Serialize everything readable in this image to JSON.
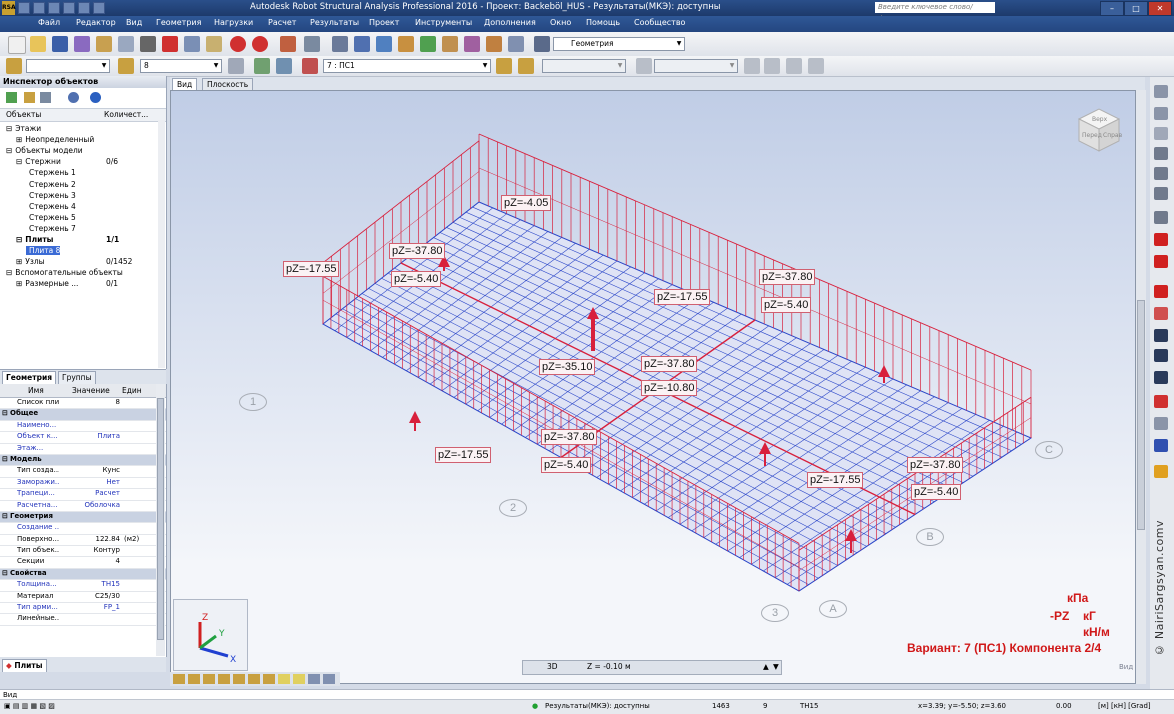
{
  "window": {
    "title": "Autodesk Robot Structural Analysis Professional 2016 - Проект: Backeböl_HUS - Результаты(МКЭ): доступны",
    "search_placeholder": "Введите ключевое слово/фразу",
    "logo": "RSA",
    "btn_min": "–",
    "btn_max": "□",
    "btn_close": "✕"
  },
  "menu": [
    "Файл",
    "Редактор",
    "Вид",
    "Геометрия",
    "Нагрузки",
    "Расчет",
    "Результаты",
    "Проект",
    "Инструменты",
    "Дополнения",
    "Окно",
    "Помощь",
    "Сообщество"
  ],
  "toolbar": {
    "layout_combo": "Геометрия",
    "section_combo": "8",
    "case_combo": "7 : ПС1"
  },
  "inspector": {
    "title": "Инспектор объектов",
    "col_objects": "Объекты",
    "col_count": "Количест...",
    "tree": [
      {
        "label": "Этажи",
        "count": "",
        "indent": 0,
        "expand": "⊟"
      },
      {
        "label": "Неопределенный",
        "count": "",
        "indent": 1,
        "expand": "⊞"
      },
      {
        "label": "Объекты модели",
        "count": "",
        "indent": 0,
        "expand": "⊟"
      },
      {
        "label": "Стержни",
        "count": "0/6",
        "indent": 1,
        "expand": "⊟"
      },
      {
        "label": "Стержень    1",
        "count": "",
        "indent": 2,
        "expand": ""
      },
      {
        "label": "Стержень    2",
        "count": "",
        "indent": 2,
        "expand": ""
      },
      {
        "label": "Стержень    3",
        "count": "",
        "indent": 2,
        "expand": ""
      },
      {
        "label": "Стержень    4",
        "count": "",
        "indent": 2,
        "expand": ""
      },
      {
        "label": "Стержень    5",
        "count": "",
        "indent": 2,
        "expand": ""
      },
      {
        "label": "Стержень    7",
        "count": "",
        "indent": 2,
        "expand": ""
      },
      {
        "label": "Плиты",
        "count": "1/1",
        "indent": 1,
        "expand": "⊟",
        "bold": true
      },
      {
        "label": "Плита    8",
        "count": "",
        "indent": 2,
        "expand": "",
        "selected": true
      },
      {
        "label": "Узлы",
        "count": "0/1452",
        "indent": 1,
        "expand": "⊞"
      },
      {
        "label": "Вспомогательные объекты",
        "count": "",
        "indent": 0,
        "expand": "⊟"
      },
      {
        "label": "Размерные ...",
        "count": "0/1",
        "indent": 1,
        "expand": "⊞"
      }
    ]
  },
  "tabs": {
    "geometry": "Геометрия",
    "groups": "Группы",
    "bottom": "Плиты"
  },
  "props": {
    "col_name": "Имя",
    "col_value": "Значение",
    "col_unit": "Един",
    "rows": [
      {
        "n": "Список плит",
        "v": "8",
        "u": "",
        "type": "plain"
      },
      {
        "n": "Общее",
        "v": "",
        "u": "",
        "type": "cat"
      },
      {
        "n": "Наимено...",
        "v": "",
        "u": "",
        "type": "blue"
      },
      {
        "n": "Объект к...",
        "v": "Плита",
        "u": "",
        "type": "blue"
      },
      {
        "n": "Этаж...",
        "v": "",
        "u": "",
        "type": "blue"
      },
      {
        "n": "Модель",
        "v": "",
        "u": "",
        "type": "cat"
      },
      {
        "n": "Тип созда...",
        "v": "Кунс",
        "u": "",
        "type": "plain"
      },
      {
        "n": "Заморажи...",
        "v": "Нет",
        "u": "",
        "type": "blue"
      },
      {
        "n": "Трапеци...",
        "v": "Расчет",
        "u": "",
        "type": "blue"
      },
      {
        "n": "Расчетна...",
        "v": "Оболочка",
        "u": "",
        "type": "blue"
      },
      {
        "n": "Геометрия",
        "v": "",
        "u": "",
        "type": "cat"
      },
      {
        "n": "Создание ...",
        "v": "",
        "u": "",
        "type": "blue"
      },
      {
        "n": "Поверхно...",
        "v": "122.84",
        "u": "(м2)",
        "type": "plain"
      },
      {
        "n": "Тип объек...",
        "v": "Контур",
        "u": "",
        "type": "plain"
      },
      {
        "n": "Секции",
        "v": "4",
        "u": "",
        "type": "plain"
      },
      {
        "n": "Свойства",
        "v": "",
        "u": "",
        "type": "cat"
      },
      {
        "n": "Толщина...",
        "v": "TH15",
        "u": "",
        "type": "blue"
      },
      {
        "n": "Материал",
        "v": "C25/30",
        "u": "",
        "type": "plain"
      },
      {
        "n": "Тип арми...",
        "v": "FP_1",
        "u": "",
        "type": "blue"
      },
      {
        "n": "Линейные...",
        "v": "",
        "u": "",
        "type": "plain"
      }
    ]
  },
  "view": {
    "tab_view": "Вид",
    "tab_plane": "Плоскость",
    "cube_top": "Верх",
    "cube_front": "Перед",
    "cube_right": "Справ",
    "mode_3d": "3D",
    "z_level": "Z = -0.10 м",
    "view_label": "Вид",
    "variant": "Вариант: 7 (ПС1) Компонента 2/4",
    "legend": {
      "u1": "кПа",
      "u2": "кГ",
      "u3": "кН/м",
      "sym": "-PZ"
    },
    "grid": [
      "1",
      "2",
      "3",
      "A",
      "B",
      "C"
    ],
    "axes": {
      "z": "Z",
      "y": "Y",
      "x": "X"
    },
    "labels": [
      "pZ=-4.05",
      "pZ=-37.80",
      "pZ=-5.40",
      "pZ=-17.55",
      "pZ=-37.80",
      "pZ=-17.55",
      "pZ=-5.40",
      "pZ=-35.10",
      "pZ=-37.80",
      "pZ=-10.80",
      "pZ=-37.80",
      "pZ=-17.55",
      "pZ=-5.40",
      "pZ=-17.55",
      "pZ=-37.80",
      "pZ=-5.40"
    ]
  },
  "watermark": "© NairiSargsyan.comv",
  "status": {
    "cmd": "Вид",
    "results": "Результаты(МКЭ): доступны",
    "nodes": "1463",
    "num2": "9",
    "thick": "TH15",
    "coords": "x=3.39; y=-5.50; z=3.60",
    "angle": "0.00",
    "units": "[м] [кН] [Grad]"
  },
  "colors": {
    "load": "#d8203c",
    "mesh": "#2e49c9",
    "accent": "#2a4f8a"
  }
}
